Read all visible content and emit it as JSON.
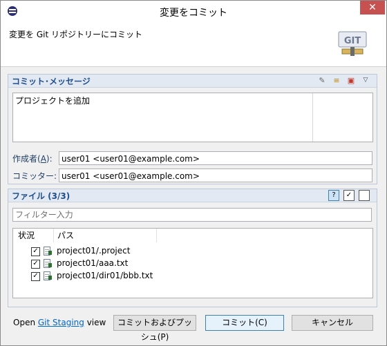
{
  "window": {
    "title": "変更をコミット",
    "close_symbol": "✕"
  },
  "header": {
    "description": "変更を Git リポジトリーにコミット",
    "logo_text": "GIT"
  },
  "commit_section": {
    "title": "コミット･メッセージ",
    "message": "プロジェクトを追加",
    "author_label_prefix": "作成者(",
    "author_label_key": "A",
    "author_label_suffix": "):",
    "author_value": "user01 <user01@example.com>",
    "committer_label": "コミッター:",
    "committer_value": "user01 <user01@example.com>"
  },
  "files_section": {
    "title": "ファイル (3/3)",
    "filter_placeholder": "フィルター入力",
    "columns": [
      "状況",
      "パス"
    ],
    "files": [
      {
        "path": "project01/.project",
        "checked": true
      },
      {
        "path": "project01/aaa.txt",
        "checked": true
      },
      {
        "path": "project01/dir01/bbb.txt",
        "checked": true
      }
    ],
    "check_mark": "✓"
  },
  "footer": {
    "open_prefix": "Open ",
    "open_link": "Git Staging",
    "open_suffix": " view",
    "commit_push_button": "コミットおよびプッシュ(P)",
    "commit_button": "コミット(C)",
    "cancel_button": "キャンセル"
  },
  "colors": {
    "section_title": "#1f4e8c",
    "link": "#0066cc",
    "close_bg": "#c75050"
  }
}
